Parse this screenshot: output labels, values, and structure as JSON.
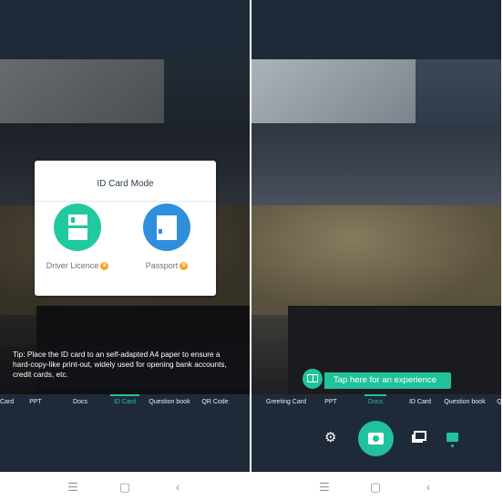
{
  "left": {
    "dialog": {
      "title": "ID Card Mode",
      "options": [
        {
          "label": "Driver Licence",
          "premium": true
        },
        {
          "label": "Passport",
          "premium": true
        }
      ]
    },
    "tip": "Tip: Place the ID card to an self-adapted A4 paper to ensure a hard-copy-like print-out, widely used for opening bank accounts, credit cards, etc.",
    "tabs": [
      "Card",
      "PPT",
      "Docs",
      "ID Card",
      "Question book",
      "QR Code"
    ],
    "active_tab": "ID Card"
  },
  "right": {
    "bubble": "Tap here for an experience",
    "tabs": [
      "Greeting Card",
      "PPT",
      "Docs",
      "ID Card",
      "Question book",
      "Q"
    ],
    "active_tab": "Docs"
  },
  "nav": {
    "menu": "☰",
    "home": "▢",
    "back": "‹"
  },
  "colors": {
    "accent": "#21c29b",
    "passport": "#2f8fdc",
    "bar": "#1f2a38"
  }
}
